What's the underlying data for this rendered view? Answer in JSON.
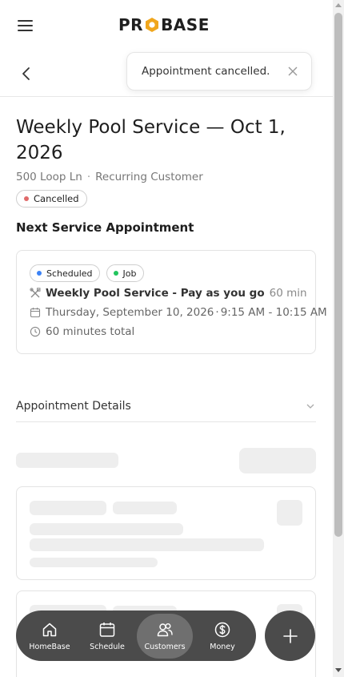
{
  "header": {
    "logo_left": "PR",
    "logo_right": "BASE",
    "menu_icon": "hamburger-menu-icon",
    "logo_icon": "hexagon-logo-icon"
  },
  "toast": {
    "message": "Appointment cancelled.",
    "close_icon": "close-icon"
  },
  "job": {
    "title": "Weekly Pool Service — Oct 1, 2026",
    "address": "500 Loop Ln",
    "customer_type": "Recurring Customer",
    "separator": "·",
    "status": "Cancelled"
  },
  "next_appointment": {
    "heading": "Next Service Appointment",
    "badges": [
      {
        "label": "Scheduled",
        "color": "#3b82f6"
      },
      {
        "label": "Job",
        "color": "#22c55e"
      }
    ],
    "service_name": "Weekly Pool Service - Pay as you go",
    "service_duration": "60 min",
    "date": "Thursday, September 10, 2026",
    "time_sep": "·",
    "time": "9:15 AM - 10:15 AM",
    "total": "60 minutes total"
  },
  "details": {
    "label": "Appointment Details"
  },
  "nav": {
    "items": [
      {
        "label": "HomeBase",
        "icon": "home-icon"
      },
      {
        "label": "Schedule",
        "icon": "calendar-icon"
      },
      {
        "label": "Customers",
        "icon": "users-icon",
        "active": true
      },
      {
        "label": "Money",
        "icon": "dollar-icon"
      }
    ],
    "fab_icon": "plus-icon"
  },
  "colors": {
    "cancelled_dot": "#e06a6a",
    "nav_bg": "#4b4b4b",
    "logo_hex": "#f0a61c"
  }
}
